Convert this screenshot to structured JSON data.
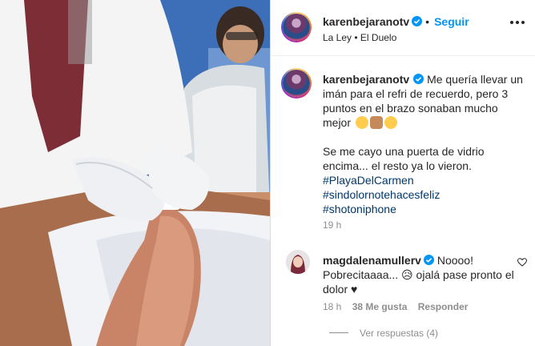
{
  "post": {
    "username": "karenbejaranotv",
    "follow_label": "Seguir",
    "location_line": "La Ley • El Duelo"
  },
  "caption": {
    "username": "karenbejaranotv",
    "text_1": "Me quería llevar un imán para el refri de recuerdo, pero 3 puntos en el brazo sonaban mucho mejor",
    "text_2": "Se me cayo una puerta de vidrio encima... el resto ya lo vieron.",
    "hashtags": [
      "#PlayaDelCarmen",
      "#sindolornotehacesfeliz",
      "#shotoniphone"
    ],
    "time": "19 h"
  },
  "comment": {
    "username": "magdalenamullerv",
    "text": "Noooo! Pobrecitaaaa... 😥 ojalá pase pronto el dolor ♥",
    "time": "18 h",
    "likes": "38 Me gusta",
    "reply_label": "Responder",
    "view_replies": "Ver respuestas (4)"
  },
  "colors": {
    "accent": "#0095f6",
    "hashtag": "#00376b",
    "muted": "#8e8e8e"
  },
  "icons": [
    "verified-badge-icon",
    "more-options-icon",
    "heart-icon"
  ]
}
